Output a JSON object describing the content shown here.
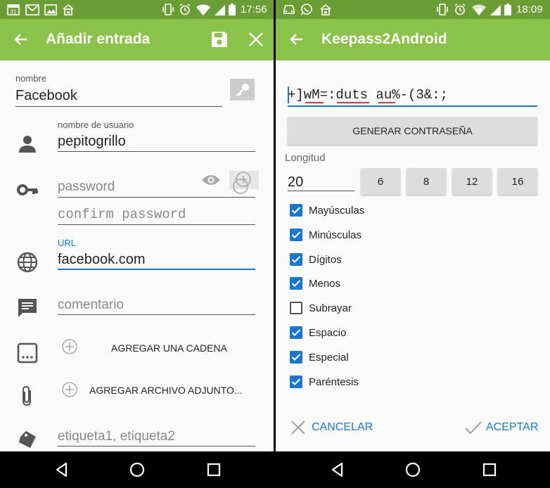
{
  "left": {
    "status": {
      "time": "17:56",
      "calendar_day": "31"
    },
    "appbar": {
      "title": "Añadir entrada"
    },
    "form": {
      "name_label": "nombre",
      "name_value": "Facebook",
      "user_label": "nombre de usuario",
      "user_value": "pepitogrillo",
      "password_placeholder": "password",
      "confirm_placeholder": "confirm password",
      "url_label": "URL",
      "url_value": "facebook.com",
      "comment_placeholder": "comentario",
      "add_string_label": "AGREGAR UNA CADENA",
      "add_attachment_label": "AGREGAR ARCHIVO ADJUNTO...",
      "tags_placeholder": "etiqueta1, etiqueta2"
    }
  },
  "right": {
    "status": {
      "time": "18:09"
    },
    "appbar": {
      "title": "Keepass2Android"
    },
    "generator": {
      "password": "+]wM=:duts au%-(3&:;",
      "generate_label": "GENERAR CONTRASEÑA",
      "length_label": "Longitud",
      "length_value": "20",
      "presets": [
        "6",
        "8",
        "12",
        "16"
      ],
      "options": [
        {
          "label": "Mayúsculas",
          "checked": true
        },
        {
          "label": "Minúsculas",
          "checked": true
        },
        {
          "label": "Dígitos",
          "checked": true
        },
        {
          "label": "Menos",
          "checked": true
        },
        {
          "label": "Subrayar",
          "checked": false
        },
        {
          "label": "Espacio",
          "checked": true
        },
        {
          "label": "Especial",
          "checked": true
        },
        {
          "label": "Paréntesis",
          "checked": true
        }
      ],
      "cancel_label": "CANCELAR",
      "accept_label": "ACEPTAR"
    },
    "colors": {
      "accent": "#1976d2",
      "appbar": "#8bc34a",
      "statusbar": "#6a9e35"
    }
  }
}
